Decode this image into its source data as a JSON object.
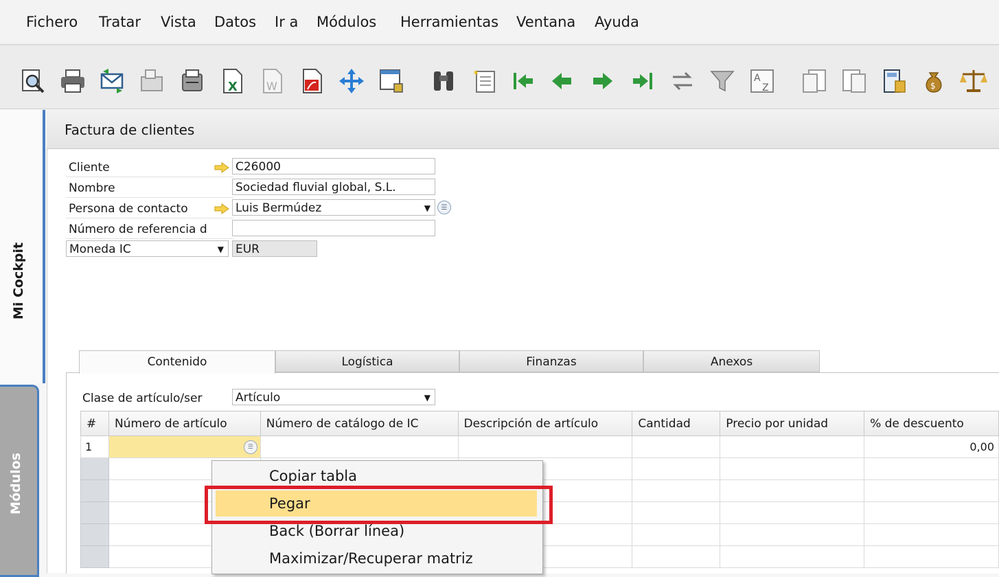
{
  "menu": {
    "items": [
      {
        "label": "Fichero",
        "ul": "F"
      },
      {
        "label": "Tratar",
        "ul": "T"
      },
      {
        "label": "Vista",
        "ul": "V"
      },
      {
        "label": "Datos",
        "ul": "D"
      },
      {
        "label": "Ir a",
        "ul": "I"
      },
      {
        "label": "Módulos",
        "ul": "M"
      },
      {
        "label": "Herramientas",
        "ul": "H"
      },
      {
        "label": "Ventana",
        "ul": "e"
      },
      {
        "label": "Ayuda",
        "ul": "A"
      }
    ]
  },
  "toolbar": {
    "icons": [
      "preview-icon",
      "print-icon",
      "email-icon",
      "fax-icon",
      "printer-icon",
      "excel-icon",
      "word-icon",
      "pdf-icon",
      "move-icon",
      "lock-window-icon",
      "binoculars-icon",
      "new-document-icon",
      "first-record-icon",
      "previous-record-icon",
      "next-record-icon",
      "last-record-icon",
      "refresh-icon",
      "filter-icon",
      "sort-icon",
      "base-document-icon",
      "target-document-icon",
      "calculator-icon",
      "money-bag-icon",
      "balance-icon"
    ]
  },
  "sidebar": {
    "cockpit_label": "Mi Cockpit",
    "modules_label": "Módulos"
  },
  "window": {
    "title": "Factura de clientes"
  },
  "header": {
    "cliente_label": "Cliente",
    "cliente_value": "C26000",
    "nombre_label": "Nombre",
    "nombre_value": "Sociedad fluvial global, S.L.",
    "contacto_label": "Persona de contacto",
    "contacto_value": "Luis Bermúdez",
    "referencia_label": "Número de referencia d",
    "referencia_value": "",
    "moneda_label": "Moneda IC",
    "moneda_value": "EUR"
  },
  "tabs": [
    {
      "label": "Contenido"
    },
    {
      "label": "Logística"
    },
    {
      "label": "Finanzas"
    },
    {
      "label": "Anexos"
    }
  ],
  "contenido": {
    "clase_label": "Clase de artículo/ser",
    "clase_value": "Artículo"
  },
  "grid": {
    "columns": [
      "#",
      "Número de artículo",
      "Número de catálogo de IC",
      "Descripción de artículo",
      "Cantidad",
      "Precio por unidad",
      "% de descuento"
    ],
    "rows": [
      {
        "num": "1",
        "descuento": "0,00"
      }
    ]
  },
  "context_menu": {
    "items": [
      "Copiar tabla",
      "Pegar",
      "Back (Borrar línea)",
      "Maximizar/Recuperar matriz"
    ],
    "highlighted": "Pegar"
  },
  "colors": {
    "highlight": "#fddf8c",
    "annotation_box": "#dc1e28",
    "sidebar_accent": "#4a7fc1"
  }
}
